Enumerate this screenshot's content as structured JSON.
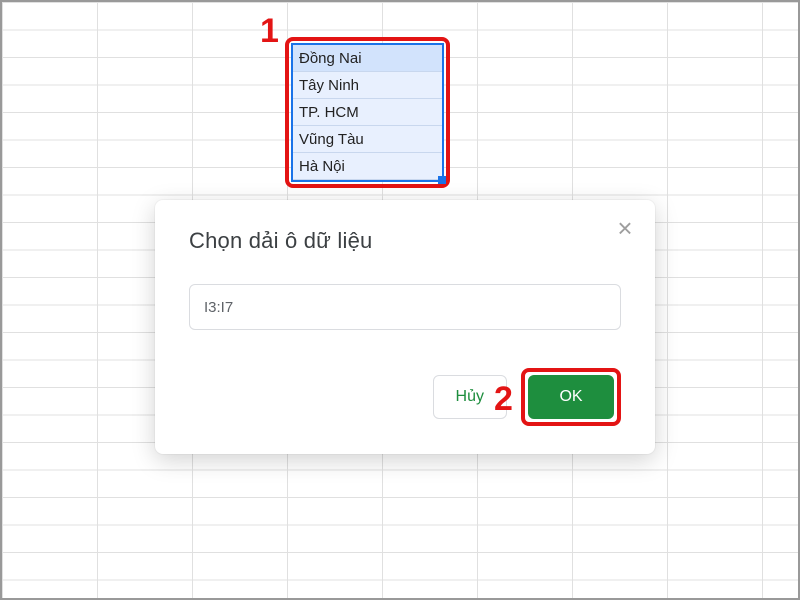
{
  "callouts": {
    "one": "1",
    "two": "2"
  },
  "selection": {
    "rows": [
      "Đồng Nai",
      "Tây Ninh",
      "TP. HCM",
      "Vũng Tàu",
      "Hà Nội"
    ]
  },
  "dialog": {
    "title": "Chọn dải ô dữ liệu",
    "range_value": "I3:I7",
    "cancel_label": "Hủy",
    "ok_label": "OK"
  }
}
